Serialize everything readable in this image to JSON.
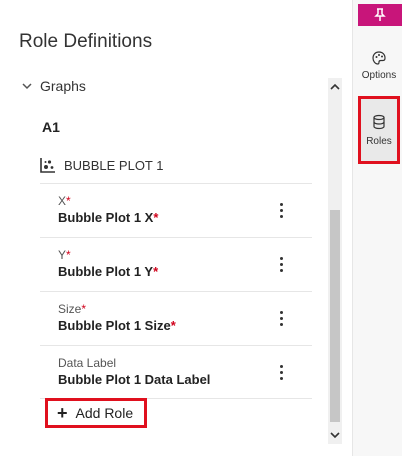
{
  "panel": {
    "title": "Role Definitions"
  },
  "tree": {
    "graphs_label": "Graphs",
    "a1_label": "A1",
    "plot_label": "BUBBLE PLOT 1"
  },
  "roles": [
    {
      "label": "X",
      "required": true,
      "value": "Bubble Plot 1 X",
      "value_required": true
    },
    {
      "label": "Y",
      "required": true,
      "value": "Bubble Plot 1 Y",
      "value_required": true
    },
    {
      "label": "Size",
      "required": true,
      "value": "Bubble Plot 1 Size",
      "value_required": true
    },
    {
      "label": "Data Label",
      "required": false,
      "value": "Bubble Plot 1 Data Label",
      "value_required": false
    }
  ],
  "add_role_label": "Add Role",
  "required_marker": "*",
  "sidebar": {
    "options_label": "Options",
    "roles_label": "Roles"
  },
  "colors": {
    "accent": "#c8157a",
    "highlight": "#e0101e",
    "required": "#d0021b"
  }
}
